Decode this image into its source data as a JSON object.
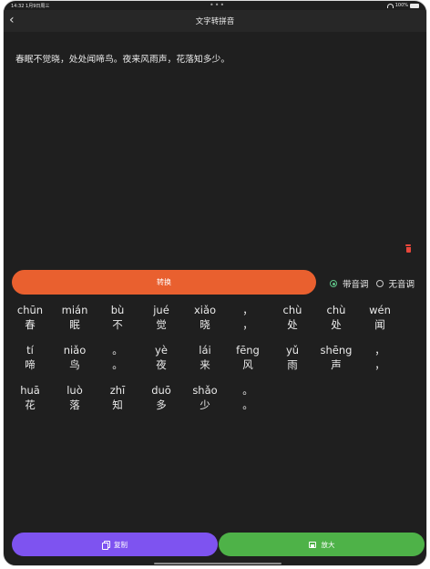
{
  "status_bar": {
    "time": "14:32",
    "date": "1月9日周三",
    "dots": "•••",
    "battery": "100%"
  },
  "nav": {
    "back_icon": "chevron-left",
    "title": "文字转拼音"
  },
  "input": {
    "text": "春眠不觉晓，处处闻啼鸟。夜来风雨声，花落知多少。"
  },
  "controls": {
    "convert_label": "转换",
    "tone_on_label": "带音调",
    "tone_off_label": "无音调",
    "tone_selected": "带音调"
  },
  "pinyin_rows": [
    [
      {
        "py": "chūn",
        "hz": "春"
      },
      {
        "py": "mián",
        "hz": "眠"
      },
      {
        "py": "bù",
        "hz": "不"
      },
      {
        "py": "jué",
        "hz": "觉"
      },
      {
        "py": "xiǎo",
        "hz": "晓"
      },
      {
        "py": "，",
        "hz": "，"
      },
      {
        "py": "chù",
        "hz": "处"
      },
      {
        "py": "chù",
        "hz": "处"
      },
      {
        "py": "wén",
        "hz": "闻"
      }
    ],
    [
      {
        "py": "tí",
        "hz": "啼"
      },
      {
        "py": "niǎo",
        "hz": "鸟"
      },
      {
        "py": "。",
        "hz": "。"
      },
      {
        "py": "yè",
        "hz": "夜"
      },
      {
        "py": "lái",
        "hz": "来"
      },
      {
        "py": "fēng",
        "hz": "风"
      },
      {
        "py": "yǔ",
        "hz": "雨"
      },
      {
        "py": "shēng",
        "hz": "声"
      },
      {
        "py": "，",
        "hz": "，"
      }
    ],
    [
      {
        "py": "huā",
        "hz": "花"
      },
      {
        "py": "luò",
        "hz": "落"
      },
      {
        "py": "zhī",
        "hz": "知"
      },
      {
        "py": "duō",
        "hz": "多"
      },
      {
        "py": "shǎo",
        "hz": "少"
      },
      {
        "py": "。",
        "hz": "。"
      }
    ]
  ],
  "actions": {
    "copy_label": "复制",
    "zoom_label": "放大"
  },
  "colors": {
    "background": "#1f1f1f",
    "convert": "#e9602f",
    "copy": "#7e53f0",
    "zoom": "#4eb248",
    "radio_active": "#5ec287",
    "delete": "#e8473b"
  }
}
